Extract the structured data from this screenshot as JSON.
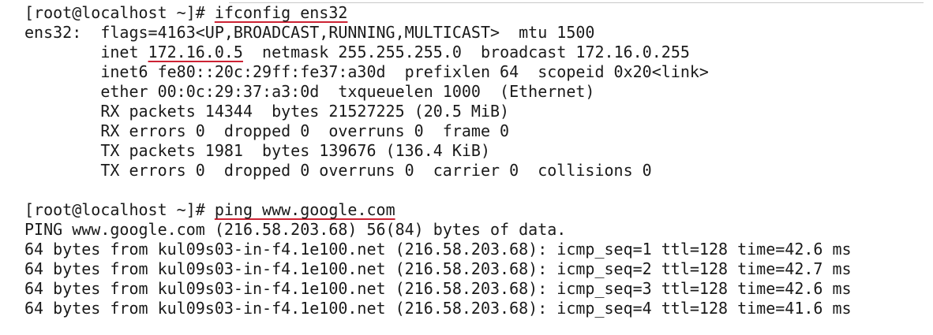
{
  "accent_underline_color": "#cc2233",
  "session1": {
    "prompt": "[root@localhost ~]# ",
    "command": "ifconfig ens32",
    "output": {
      "line1": "ens32:  flags=4163<UP,BROADCAST,RUNNING,MULTICAST>  mtu 1500",
      "inet_label": "        inet ",
      "inet_ip": "172.16.0.5",
      "inet_rest": "  netmask 255.255.255.0  broadcast 172.16.0.255",
      "inet6": "        inet6 fe80::20c:29ff:fe37:a30d  prefixlen 64  scopeid 0x20<link>",
      "ether": "        ether 00:0c:29:37:a3:0d  txqueuelen 1000  (Ethernet)",
      "rx_packets": "        RX packets 14344  bytes 21527225 (20.5 MiB)",
      "rx_errors": "        RX errors 0  dropped 0  overruns 0  frame 0",
      "tx_packets": "        TX packets 1981  bytes 139676 (136.4 KiB)",
      "tx_errors": "        TX errors 0  dropped 0 overruns 0  carrier 0  collisions 0"
    }
  },
  "session2": {
    "prompt": "[root@localhost ~]# ",
    "command": "ping www.google.com",
    "output": {
      "ping_header": "PING www.google.com (216.58.203.68) 56(84) bytes of data.",
      "replies": [
        "64 bytes from kul09s03-in-f4.1e100.net (216.58.203.68): icmp_seq=1 ttl=128 time=42.6 ms",
        "64 bytes from kul09s03-in-f4.1e100.net (216.58.203.68): icmp_seq=2 ttl=128 time=42.7 ms",
        "64 bytes from kul09s03-in-f4.1e100.net (216.58.203.68): icmp_seq=3 ttl=128 time=42.6 ms",
        "64 bytes from kul09s03-in-f4.1e100.net (216.58.203.68): icmp_seq=4 ttl=128 time=41.6 ms"
      ]
    }
  }
}
